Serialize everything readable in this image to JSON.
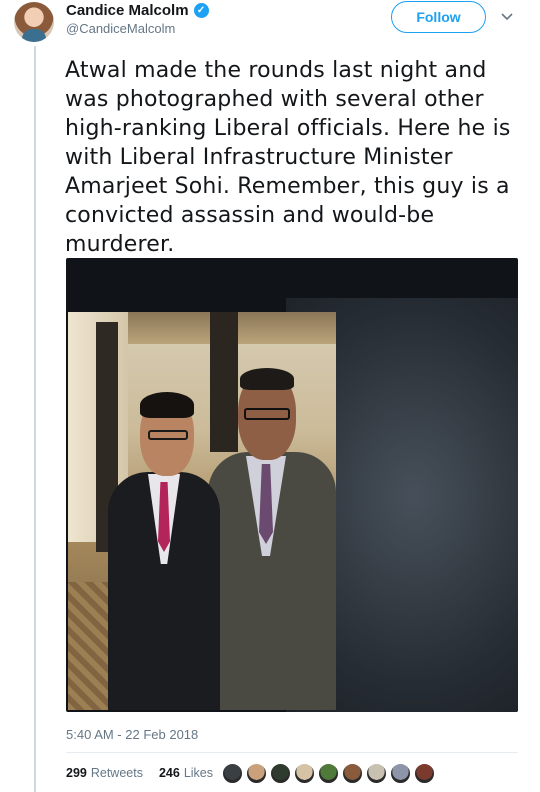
{
  "author": {
    "display_name": "Candice Malcolm",
    "handle": "@CandiceMalcolm",
    "verified": true,
    "avatar_icon": "user-avatar-icon",
    "verified_icon": "verified-badge-icon"
  },
  "actions": {
    "follow_label": "Follow",
    "more_icon": "chevron-down-icon"
  },
  "tweet": {
    "text": "Atwal made the rounds last night and was photographed with several other high-ranking Liberal officials. Here he is with Liberal Infrastructure Minister Amarjeet Sohi. Remember, this guy is a convicted assassin and would-be murderer.",
    "timestamp": "5:40 AM - 22 Feb 2018"
  },
  "stats": {
    "retweets_count": "299",
    "retweets_label": "Retweets",
    "likes_count": "246",
    "likes_label": "Likes"
  },
  "likers": {
    "colors": [
      "#3a3f44",
      "#c9a27c",
      "#2f3b2f",
      "#d6c3a5",
      "#4f7a3a",
      "#8a5a3c",
      "#c8c0b0",
      "#8d96a8",
      "#7a3a2e"
    ]
  },
  "colors": {
    "accent": "#1da1f2",
    "text": "#14171a",
    "muted": "#657786"
  }
}
